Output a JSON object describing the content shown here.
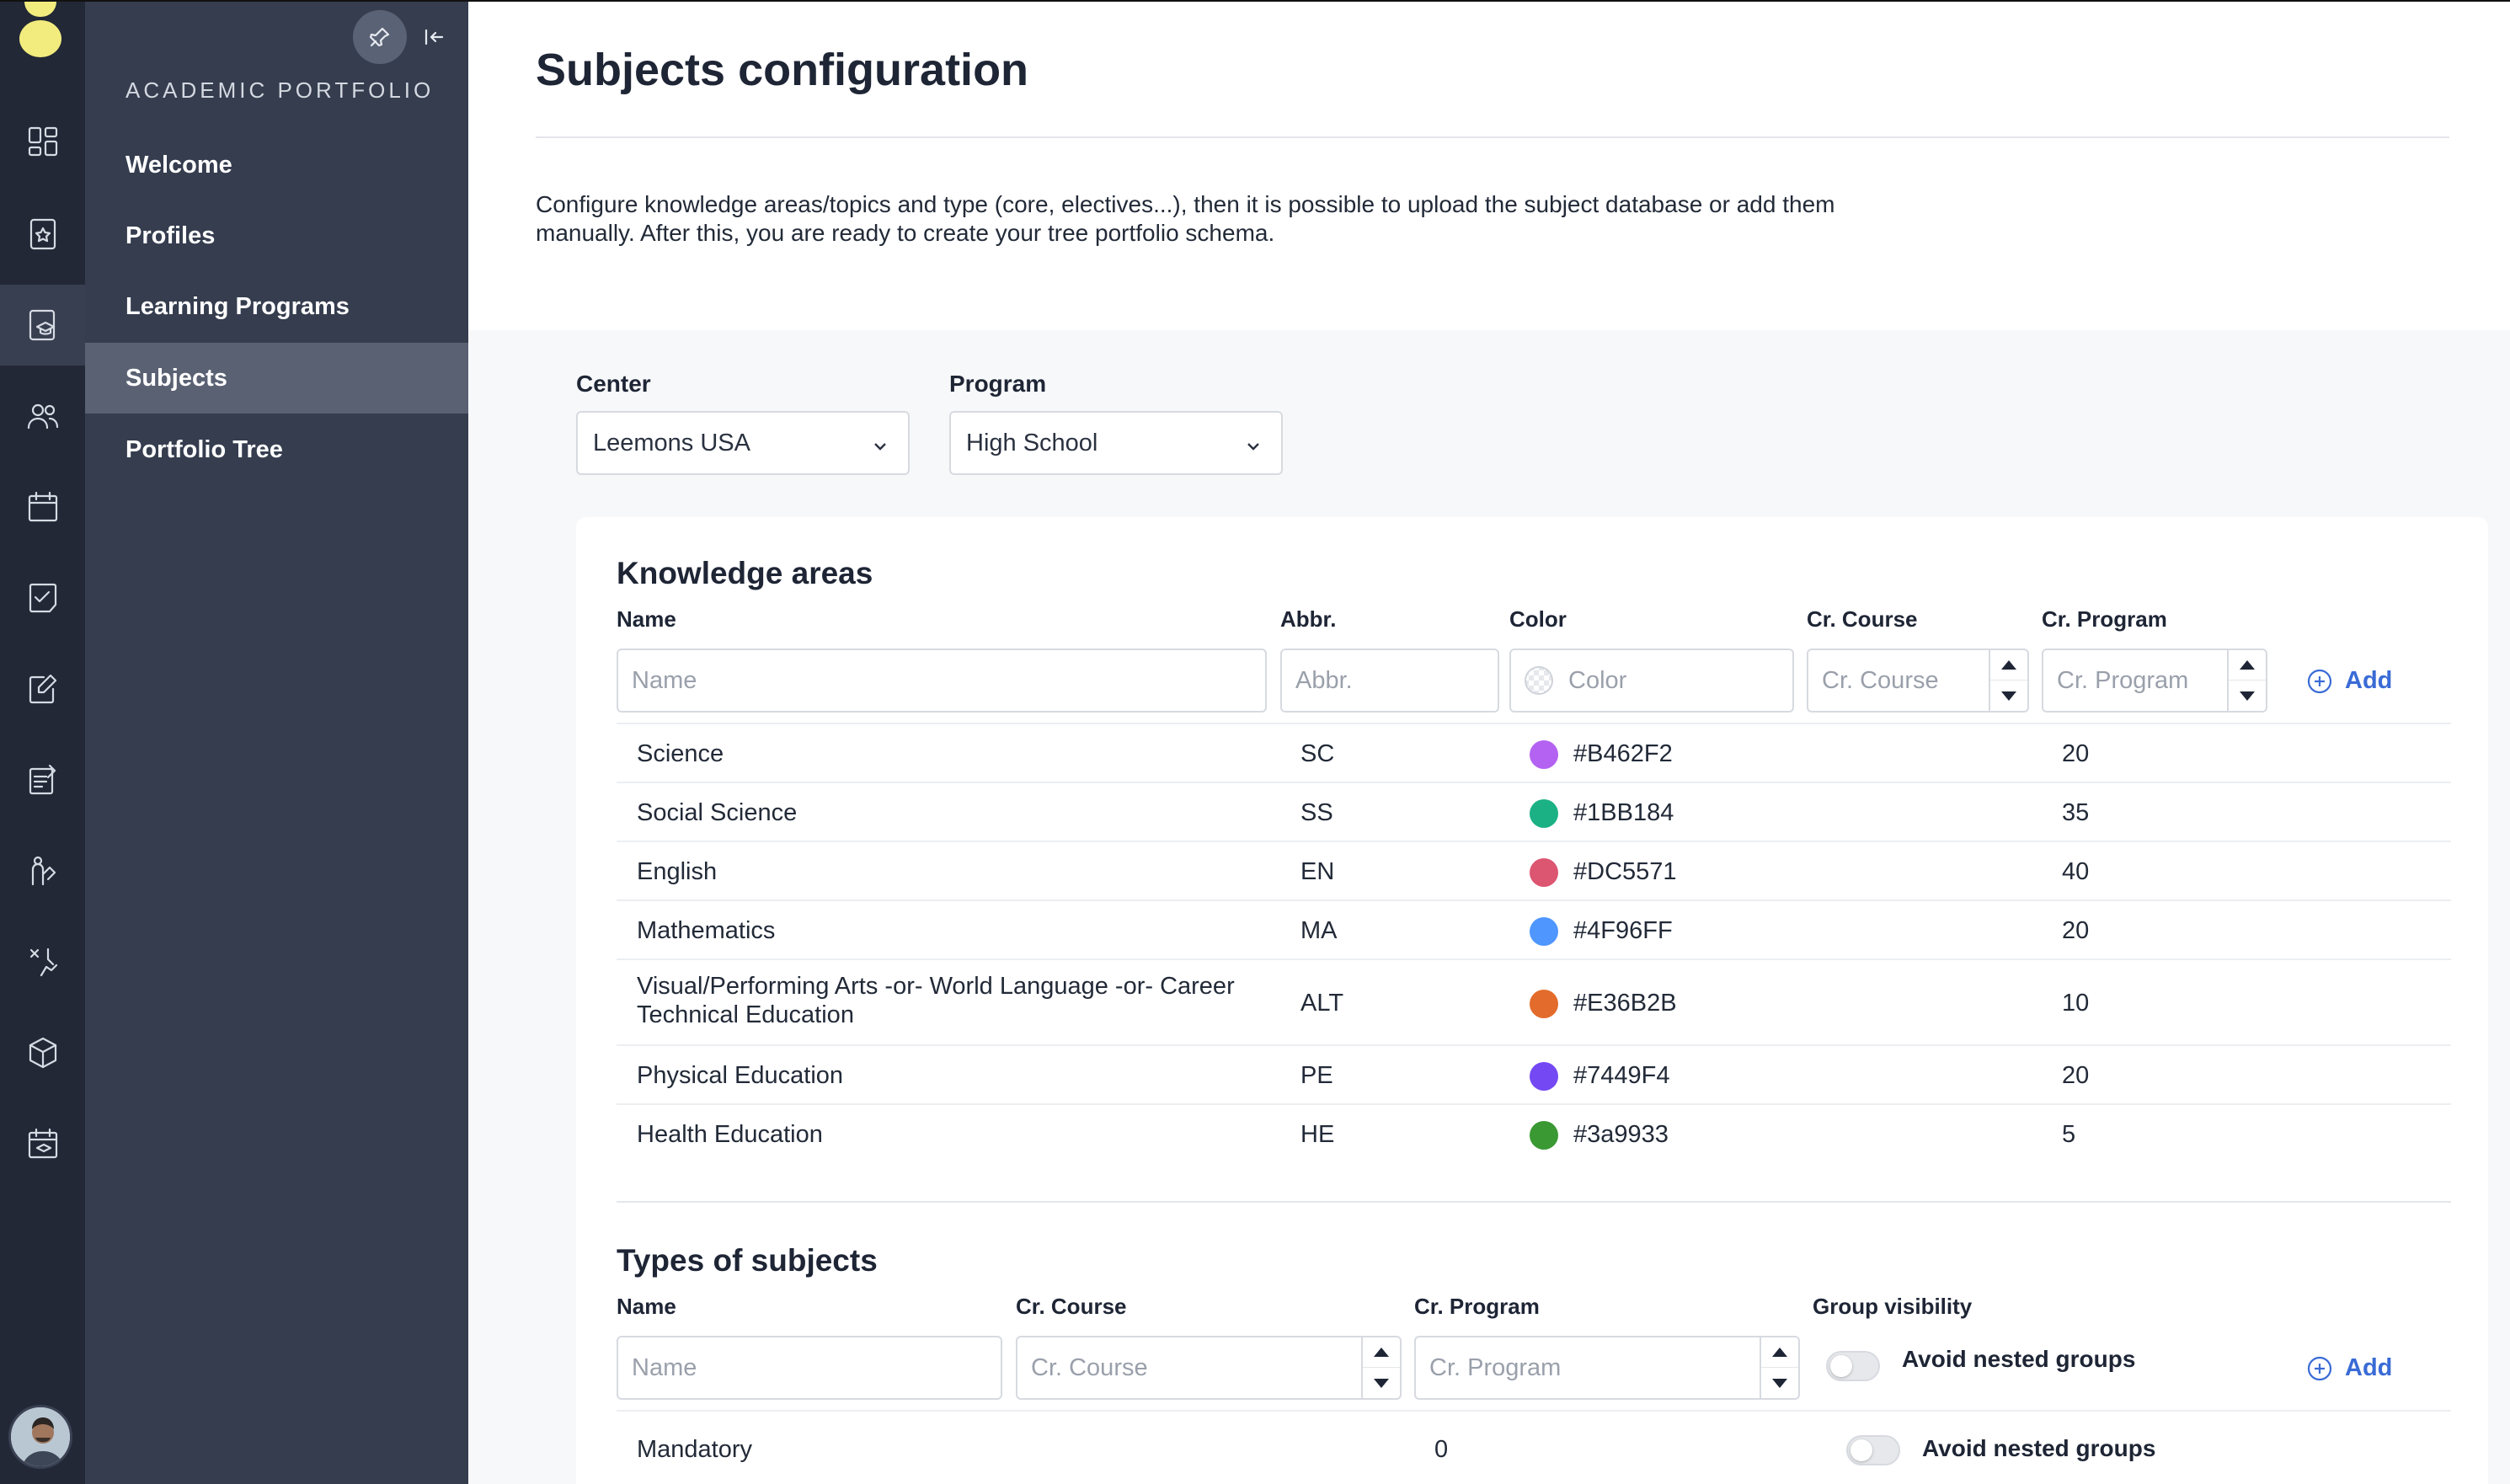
{
  "rail": {
    "icons": [
      "dashboard-icon",
      "tablet-star-icon",
      "tablet-graduation-icon",
      "users-icon",
      "calendar-icon",
      "checklist-icon",
      "edit-note-icon",
      "assignment-icon",
      "feedback-icon",
      "tools-icon",
      "package-icon",
      "calendar-graduation-icon"
    ],
    "active_index": 2
  },
  "subnav": {
    "title": "ACADEMIC PORTFOLIO",
    "items": [
      {
        "label": "Welcome"
      },
      {
        "label": "Profiles"
      },
      {
        "label": "Learning Programs"
      },
      {
        "label": "Subjects"
      },
      {
        "label": "Portfolio Tree"
      }
    ],
    "active_index": 3
  },
  "page": {
    "title": "Subjects configuration",
    "description": "Configure knowledge areas/topics and type (core, electives...), then it is possible to upload the subject database or add them manually. After this, you are ready to create your tree portfolio schema."
  },
  "filters": {
    "center": {
      "label": "Center",
      "value": "Leemons USA"
    },
    "program": {
      "label": "Program",
      "value": "High School"
    }
  },
  "knowledge_areas": {
    "title": "Knowledge areas",
    "columns": {
      "name": "Name",
      "abbr": "Abbr.",
      "color": "Color",
      "cr_course": "Cr. Course",
      "cr_program": "Cr. Program"
    },
    "placeholders": {
      "name": "Name",
      "abbr": "Abbr.",
      "color": "Color",
      "cr_course": "Cr. Course",
      "cr_program": "Cr. Program"
    },
    "add_label": "Add",
    "rows": [
      {
        "name": "Science",
        "abbr": "SC",
        "color": "#B462F2",
        "cr_program": "20"
      },
      {
        "name": "Social Science",
        "abbr": "SS",
        "color": "#1BB184",
        "cr_program": "35"
      },
      {
        "name": "English",
        "abbr": "EN",
        "color": "#DC5571",
        "cr_program": "40"
      },
      {
        "name": "Mathematics",
        "abbr": "MA",
        "color": "#4F96FF",
        "cr_program": "20"
      },
      {
        "name": "Visual/Performing Arts -or- World Language -or- Career Technical Education",
        "abbr": "ALT",
        "color": "#E36B2B",
        "cr_program": "10"
      },
      {
        "name": "Physical Education",
        "abbr": "PE",
        "color": "#7449F4",
        "cr_program": "20"
      },
      {
        "name": "Health Education",
        "abbr": "HE",
        "color": "#3a9933",
        "cr_program": "5"
      }
    ]
  },
  "subject_types": {
    "title": "Types of subjects",
    "columns": {
      "name": "Name",
      "cr_course": "Cr. Course",
      "cr_program": "Cr. Program",
      "group_visibility": "Group visibility"
    },
    "placeholders": {
      "name": "Name",
      "cr_course": "Cr. Course",
      "cr_program": "Cr. Program"
    },
    "toggle_label": "Avoid nested groups",
    "add_label": "Add",
    "rows": [
      {
        "name": "Mandatory",
        "cr_program": "0",
        "toggle_label": "Avoid nested groups"
      }
    ]
  }
}
